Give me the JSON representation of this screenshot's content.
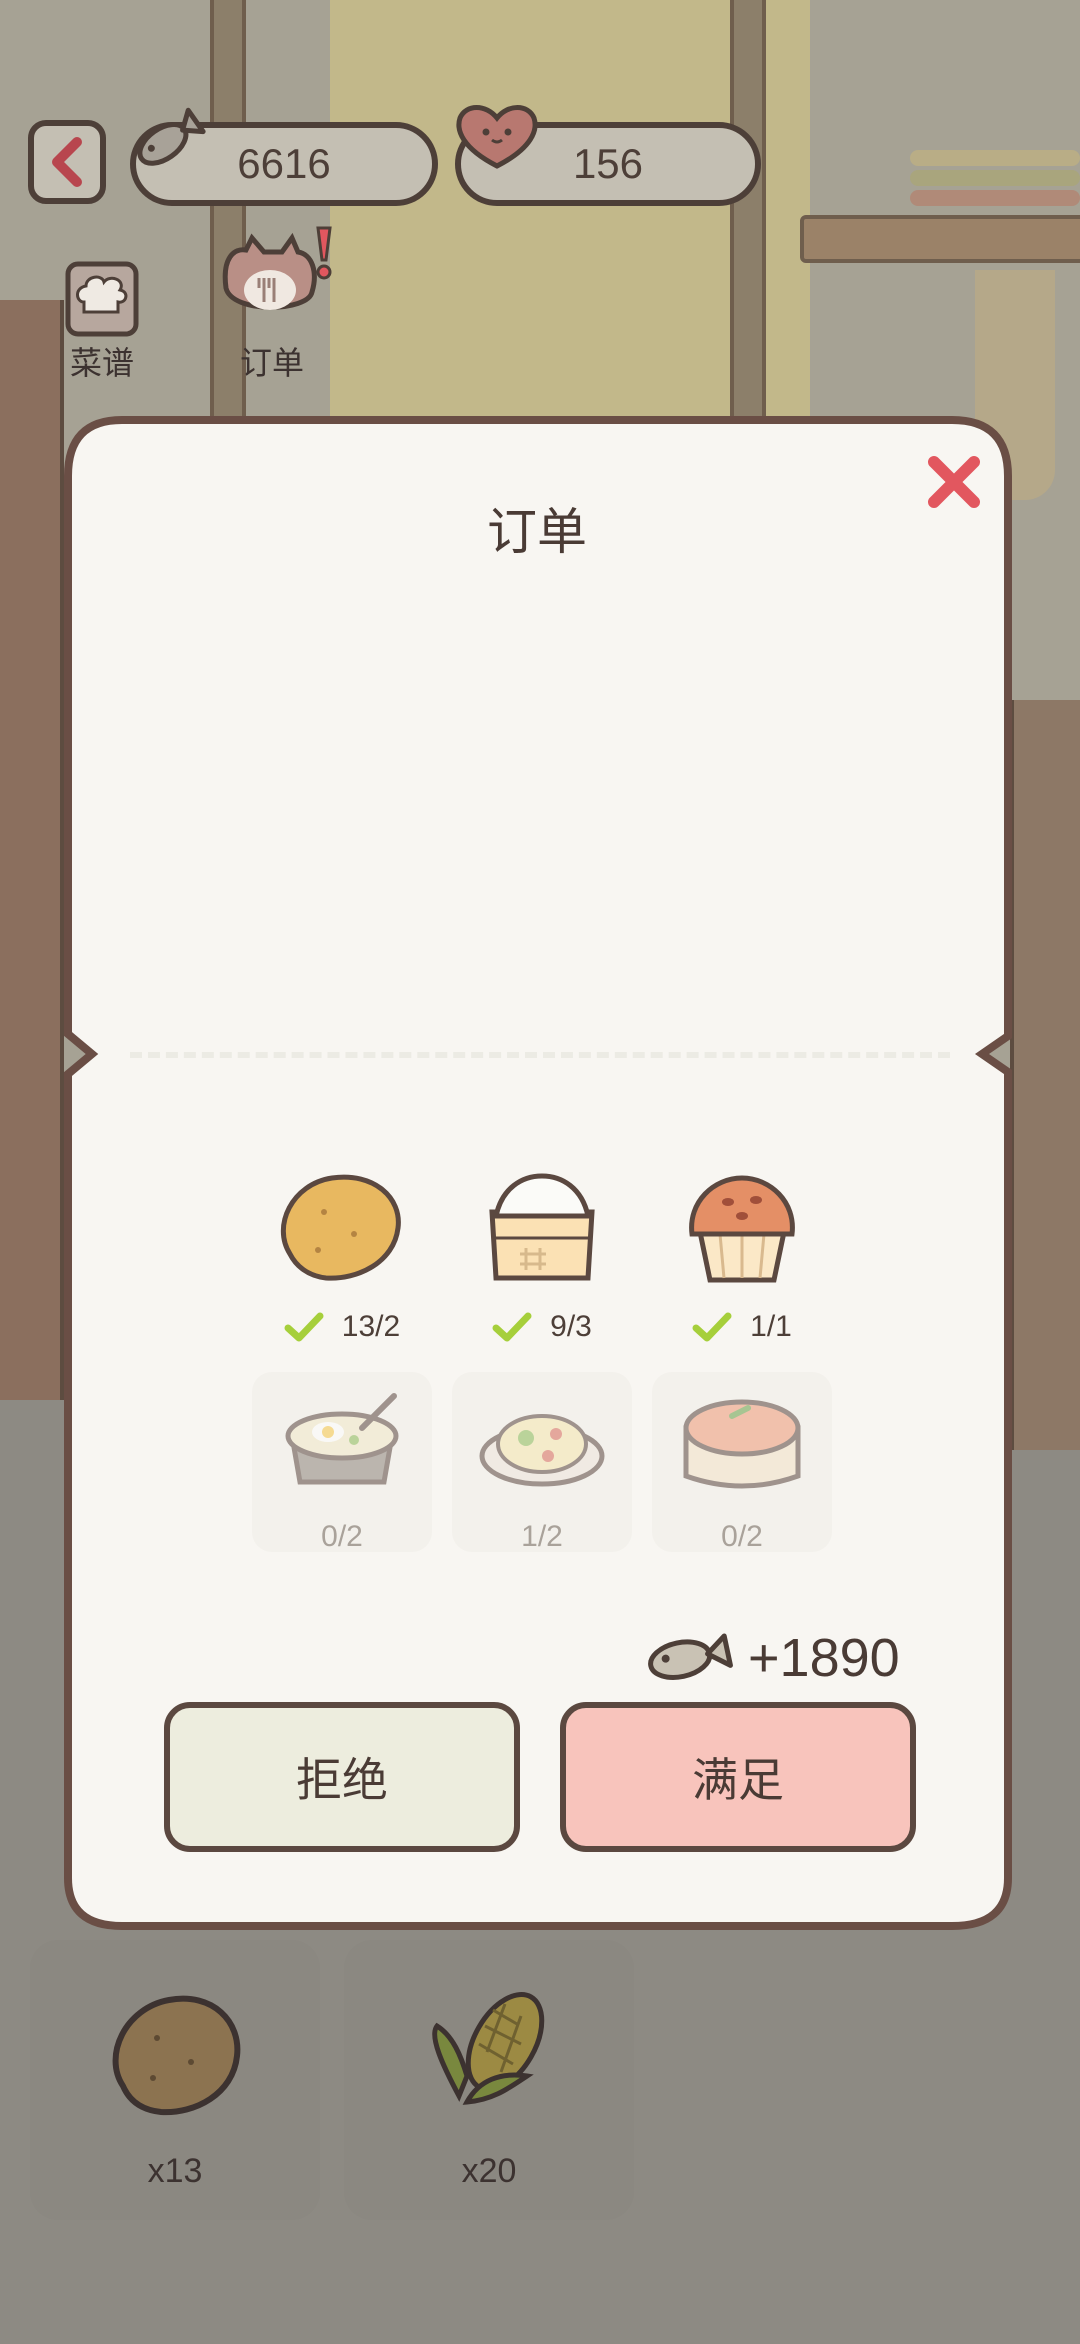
{
  "hud": {
    "fish_currency": "6616",
    "heart_currency": "156"
  },
  "tabs": [
    {
      "label": "菜谱",
      "icon": "chef-hat-icon"
    },
    {
      "label": "订单",
      "icon": "cat-plate-icon",
      "alert": "!"
    }
  ],
  "modal": {
    "title": "订单",
    "ingredients": [
      {
        "icon": "potato-icon",
        "count": "13/2",
        "done": true
      },
      {
        "icon": "flour-sack-icon",
        "count": "9/3",
        "done": true
      },
      {
        "icon": "muffin-icon",
        "count": "1/1",
        "done": true
      }
    ],
    "dishes": [
      {
        "icon": "stew-pot-icon",
        "count": "0/2"
      },
      {
        "icon": "fried-rice-icon",
        "count": "1/2"
      },
      {
        "icon": "cake-icon",
        "count": "0/2"
      }
    ],
    "reward": "+1890",
    "reject_label": "拒绝",
    "accept_label": "满足"
  },
  "inventory": [
    {
      "icon": "potato-icon",
      "qty": "x13"
    },
    {
      "icon": "corn-icon",
      "qty": "x20"
    }
  ],
  "colors": {
    "accent_pink": "#f8c4bc",
    "outline_brown": "#5b4840",
    "panel_cream": "#f8f6f2",
    "check_green": "#a6cf3b",
    "close_red": "#e2575f"
  }
}
